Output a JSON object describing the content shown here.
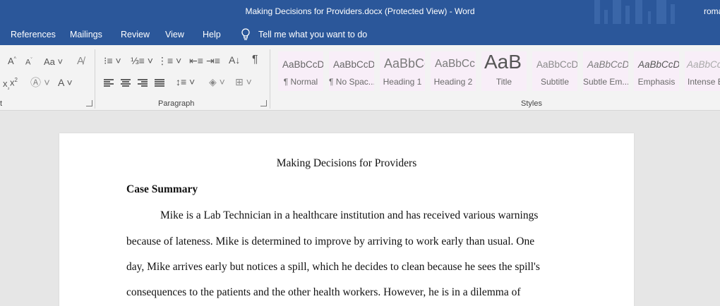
{
  "titlebar": {
    "title": "Making Decisions for Providers.docx (Protected View)  -  Word",
    "user": "roma"
  },
  "menu": {
    "tabs": [
      "References",
      "Mailings",
      "Review",
      "View",
      "Help"
    ],
    "tell_me": "Tell me what you want to do"
  },
  "ribbon": {
    "font_group_label": "t",
    "paragraph_group_label": "Paragraph",
    "styles_group_label": "Styles",
    "styles": [
      {
        "sample": "AaBbCcDc",
        "name": "¶ Normal"
      },
      {
        "sample": "AaBbCcDc",
        "name": "¶ No Spac..."
      },
      {
        "sample": "AaBbCc",
        "name": "Heading 1"
      },
      {
        "sample": "AaBbCcD",
        "name": "Heading 2"
      },
      {
        "sample": "AaB",
        "name": "Title"
      },
      {
        "sample": "AaBbCcD",
        "name": "Subtitle"
      },
      {
        "sample": "AaBbCcDc",
        "name": "Subtle Em..."
      },
      {
        "sample": "AaBbCcDc",
        "name": "Emphasis"
      },
      {
        "sample": "AaBbCcDc",
        "name": "Intense E"
      }
    ]
  },
  "document": {
    "title": "Making Decisions for Providers",
    "heading": "Case Summary",
    "lines": [
      "Mike is a Lab Technician in a healthcare institution and has received various warnings",
      "because of lateness. Mike is determined to improve by arriving to work early than usual. One",
      "day, Mike arrives early but notices a spill, which he decides to clean because he sees the spill's",
      "consequences to the patients and the other health workers. However, he is in a dilemma of"
    ]
  },
  "colors": {
    "word_blue": "#2b579a",
    "ribbon_bg": "#f3f3f3",
    "canvas_bg": "#e6e6e6",
    "style_tile_bg": "#f8eef8"
  }
}
